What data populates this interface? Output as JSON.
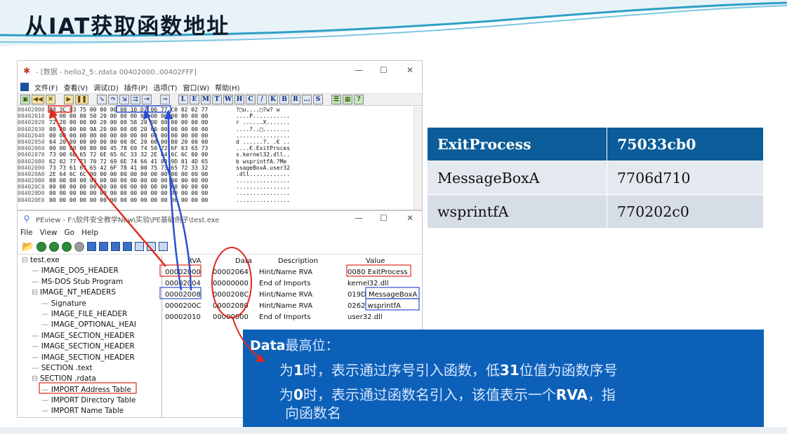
{
  "slide": {
    "title": "从IAT获取函数地址"
  },
  "olly": {
    "title": "- [数据 - hello2_5:.rdata 00402000..00402FFF]",
    "menu": [
      "文件(F)",
      "查看(V)",
      "调试(D)",
      "插件(P)",
      "选项(T)",
      "窗口(W)",
      "帮助(H)"
    ],
    "toolbar": [
      "L",
      "E",
      "M",
      "T",
      "W",
      "H",
      "C",
      "/",
      "K",
      "B",
      "R",
      "...",
      "S"
    ],
    "dump": {
      "addresses": [
        "00402000",
        "00402010",
        "00402020",
        "00402030",
        "00402040",
        "00402050",
        "00402060",
        "00402070",
        "00402080",
        "00402090",
        "004020A0",
        "004020B0",
        "004020C0",
        "004020D0",
        "004020E0"
      ],
      "hex": [
        "B0 3C 03 75 00 00 00 00 10 D7 06 77 C0 02 02 77",
        "00 00 00 00 50 20 00 00 00 00 00 00 00 00 00 00",
        "72 20 00 00 00 20 00 00 58 20 00 00 00 00 00 00",
        "00 00 00 00 9A 20 00 00 08 20 00 00 00 00 00 00",
        "00 00 00 00 00 00 00 00 00 00 00 00 00 00 00 00",
        "64 20 00 00 00 00 00 00 8C 20 00 00 80 20 00 00",
        "00 00 00 00 80 00 45 78 69 74 50 72 6F 63 65 73",
        "73 00 6B 65 72 6E 65 6C 33 32 2E 64 6C 6C 00 00",
        "62 02 77 73 70 72 69 6E 74 66 41 00 9D 01 4D 65",
        "73 73 61 67 65 42 6F 78 41 00 75 73 65 72 33 32",
        "2E 64 6C 6C 00 00 00 00 00 00 00 00 00 00 00 00",
        "00 00 00 00 00 00 00 00 00 00 00 00 00 00 00 00",
        "00 00 00 00 00 00 00 00 00 00 00 00 00 00 00 00",
        "00 00 00 00 00 00 00 00 00 00 00 00 00 00 00 00",
        "00 00 00 00 00 00 00 00 00 00 00 00 00 00 00 00"
      ],
      "text": [
        "?□u....□?w? w",
        "....P...........",
        "r ......X.......",
        "....?..□........",
        "................",
        "d ......?. .€ ..",
        "....€.ExitProces",
        "s.kernel32.dll..",
        "b wsprintfA.?Me",
        "ssageBoxA.user32",
        ".dll............",
        "................",
        "................",
        "................",
        "................"
      ]
    }
  },
  "peview": {
    "title": "PEview - F:\\软件安全教学New\\实验\\PE基础例子\\test.exe",
    "menu": [
      "File",
      "View",
      "Go",
      "Help"
    ],
    "tree": [
      {
        "t": "test.exe",
        "d": 0
      },
      {
        "t": "IMAGE_DOS_HEADER",
        "d": 1
      },
      {
        "t": "MS-DOS Stub Program",
        "d": 1
      },
      {
        "t": "IMAGE_NT_HEADERS",
        "d": 1
      },
      {
        "t": "Signature",
        "d": 2
      },
      {
        "t": "IMAGE_FILE_HEADER",
        "d": 2
      },
      {
        "t": "IMAGE_OPTIONAL_HEAI",
        "d": 2
      },
      {
        "t": "IMAGE_SECTION_HEADER",
        "d": 1
      },
      {
        "t": "IMAGE_SECTION_HEADER",
        "d": 1
      },
      {
        "t": "IMAGE_SECTION_HEADER",
        "d": 1
      },
      {
        "t": "SECTION .text",
        "d": 1
      },
      {
        "t": "SECTION .rdata",
        "d": 1
      },
      {
        "t": "IMPORT Address Table",
        "d": 2
      },
      {
        "t": "IMPORT Directory Table",
        "d": 2
      },
      {
        "t": "IMPORT Name Table",
        "d": 2
      }
    ],
    "headers": [
      "RVA",
      "Data",
      "Description",
      "Value"
    ],
    "rows": [
      {
        "rva": "00002000",
        "data": "00002064",
        "desc": "Hint/Name RVA",
        "value": "0080  ExitProcess"
      },
      {
        "rva": "00002004",
        "data": "00000000",
        "desc": "End of Imports",
        "value": "kernel32.dll"
      },
      {
        "rva": "00002008",
        "data": "0000208C",
        "desc": "Hint/Name RVA",
        "value": "019D  MessageBoxA"
      },
      {
        "rva": "0000200C",
        "data": "00002080",
        "desc": "Hint/Name RVA",
        "value": "0262  wsprintfA"
      },
      {
        "rva": "00002010",
        "data": "00000000",
        "desc": "End of Imports",
        "value": "user32.dll"
      }
    ]
  },
  "addr_table": [
    [
      "ExitProcess",
      "75033cb0"
    ],
    [
      "MessageBoxA",
      "7706d710"
    ],
    [
      "wsprintfA",
      "770202c0"
    ]
  ],
  "note": {
    "heading_bold": "Data",
    "heading_rest": "最高位：",
    "l1a": "为",
    "l1b": "1",
    "l1c": "时，表示通过序号引入函数，低",
    "l1d": "31",
    "l1e": "位值为函数序号",
    "l2a": "为",
    "l2b": "0",
    "l2c": "时，表示通过函数名引入，该值表示一个",
    "l2d": "RVA",
    "l2e": "，指",
    "l3": "向函数名"
  }
}
